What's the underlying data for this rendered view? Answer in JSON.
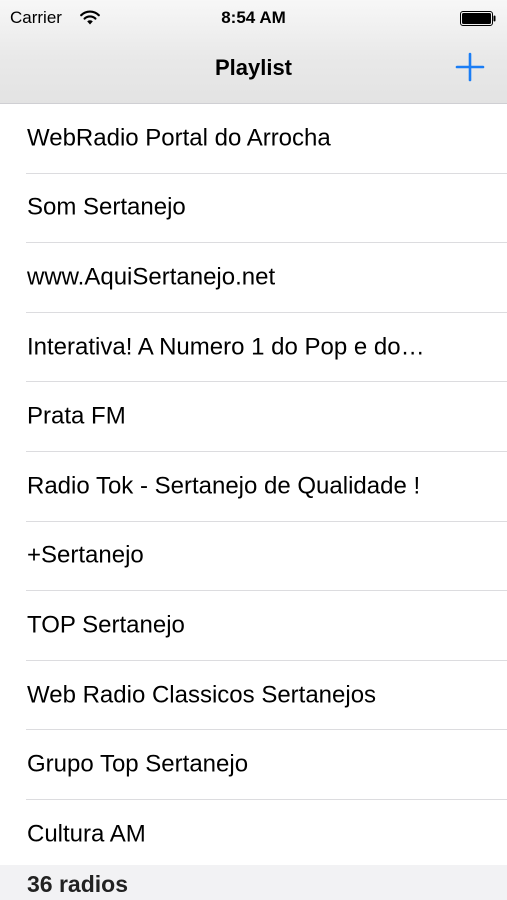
{
  "status_bar": {
    "carrier": "Carrier",
    "time": "8:54 AM",
    "wifi_icon": "wifi-icon",
    "battery_icon": "battery-icon"
  },
  "nav": {
    "title": "Playlist",
    "add_icon": "plus-icon",
    "accent_color": "#1a7df5"
  },
  "playlist": {
    "items": [
      {
        "label": "WebRadio Portal do Arrocha"
      },
      {
        "label": "Som Sertanejo"
      },
      {
        "label": "www.AquiSertanejo.net"
      },
      {
        "label": "Interativa! A Numero 1 do Pop e do…"
      },
      {
        "label": "Prata FM"
      },
      {
        "label": "Radio Tok - Sertanejo de Qualidade !"
      },
      {
        "label": "+Sertanejo"
      },
      {
        "label": "TOP Sertanejo"
      },
      {
        "label": "Web Radio Classicos Sertanejos"
      },
      {
        "label": "Grupo Top Sertanejo"
      },
      {
        "label": "Cultura AM"
      }
    ]
  },
  "footer": {
    "count_label": "36 radios"
  }
}
